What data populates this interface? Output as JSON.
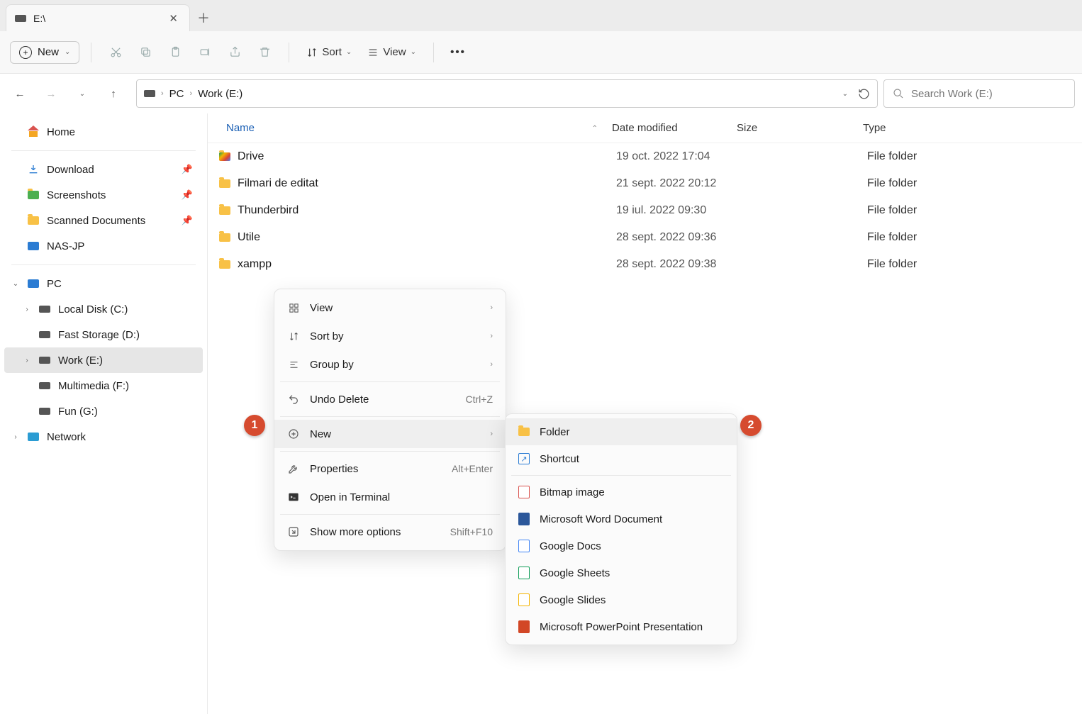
{
  "tab": {
    "title": "E:\\"
  },
  "toolbar": {
    "new_label": "New",
    "sort_label": "Sort",
    "view_label": "View"
  },
  "breadcrumb": {
    "pc": "PC",
    "drive": "Work (E:)"
  },
  "search": {
    "placeholder": "Search Work (E:)"
  },
  "sidebar": {
    "home": "Home",
    "quick": [
      {
        "label": "Download"
      },
      {
        "label": "Screenshots"
      },
      {
        "label": "Scanned Documents"
      },
      {
        "label": "NAS-JP"
      }
    ],
    "pc": "PC",
    "drives": [
      {
        "label": "Local Disk (C:)"
      },
      {
        "label": "Fast Storage (D:)"
      },
      {
        "label": "Work (E:)"
      },
      {
        "label": "Multimedia (F:)"
      },
      {
        "label": "Fun (G:)"
      }
    ],
    "network": "Network"
  },
  "columns": {
    "name": "Name",
    "date": "Date modified",
    "size": "Size",
    "type": "Type"
  },
  "rows": [
    {
      "name": "Drive",
      "date": "19 oct. 2022 17:04",
      "type": "File folder",
      "icon": "drive-app"
    },
    {
      "name": "Filmari de editat",
      "date": "21 sept. 2022 20:12",
      "type": "File folder",
      "icon": "folder"
    },
    {
      "name": "Thunderbird",
      "date": "19 iul. 2022 09:30",
      "type": "File folder",
      "icon": "folder"
    },
    {
      "name": "Utile",
      "date": "28 sept. 2022 09:36",
      "type": "File folder",
      "icon": "folder"
    },
    {
      "name": "xampp",
      "date": "28 sept. 2022 09:38",
      "type": "File folder",
      "icon": "folder"
    }
  ],
  "context_menu": {
    "view": "View",
    "sort_by": "Sort by",
    "group_by": "Group by",
    "undo_delete": "Undo Delete",
    "undo_shortcut": "Ctrl+Z",
    "new": "New",
    "properties": "Properties",
    "properties_shortcut": "Alt+Enter",
    "open_terminal": "Open in Terminal",
    "show_more": "Show more options",
    "show_more_shortcut": "Shift+F10"
  },
  "submenu": {
    "items": [
      "Folder",
      "Shortcut",
      "Bitmap image",
      "Microsoft Word Document",
      "Google Docs",
      "Google Sheets",
      "Google Slides",
      "Microsoft PowerPoint Presentation"
    ]
  },
  "badges": {
    "one": "1",
    "two": "2"
  }
}
